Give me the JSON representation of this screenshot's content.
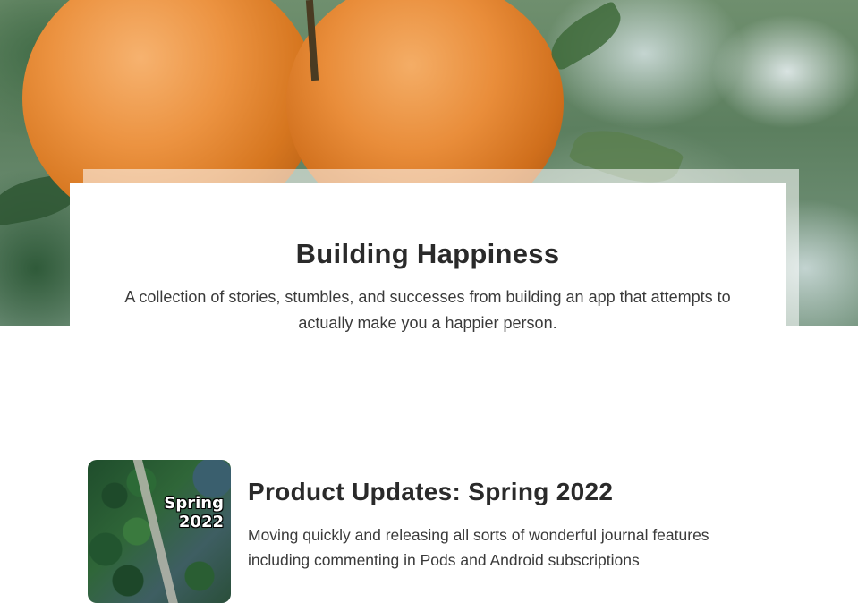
{
  "hero": {
    "title": "Building Happiness",
    "tagline": "A collection of stories, stumbles, and successes from building an app that attempts to actually make you a happier person."
  },
  "posts": [
    {
      "title": "Product Updates: Spring 2022",
      "excerpt": "Moving quickly and releasing all sorts of wonderful journal features including commenting in Pods and Android subscriptions",
      "thumbnail_text": [
        "Spring",
        "2022"
      ]
    }
  ],
  "colors": {
    "text_dark": "#2a2a2a",
    "text_body": "#3a3a3a",
    "card_bg": "#ffffff"
  }
}
